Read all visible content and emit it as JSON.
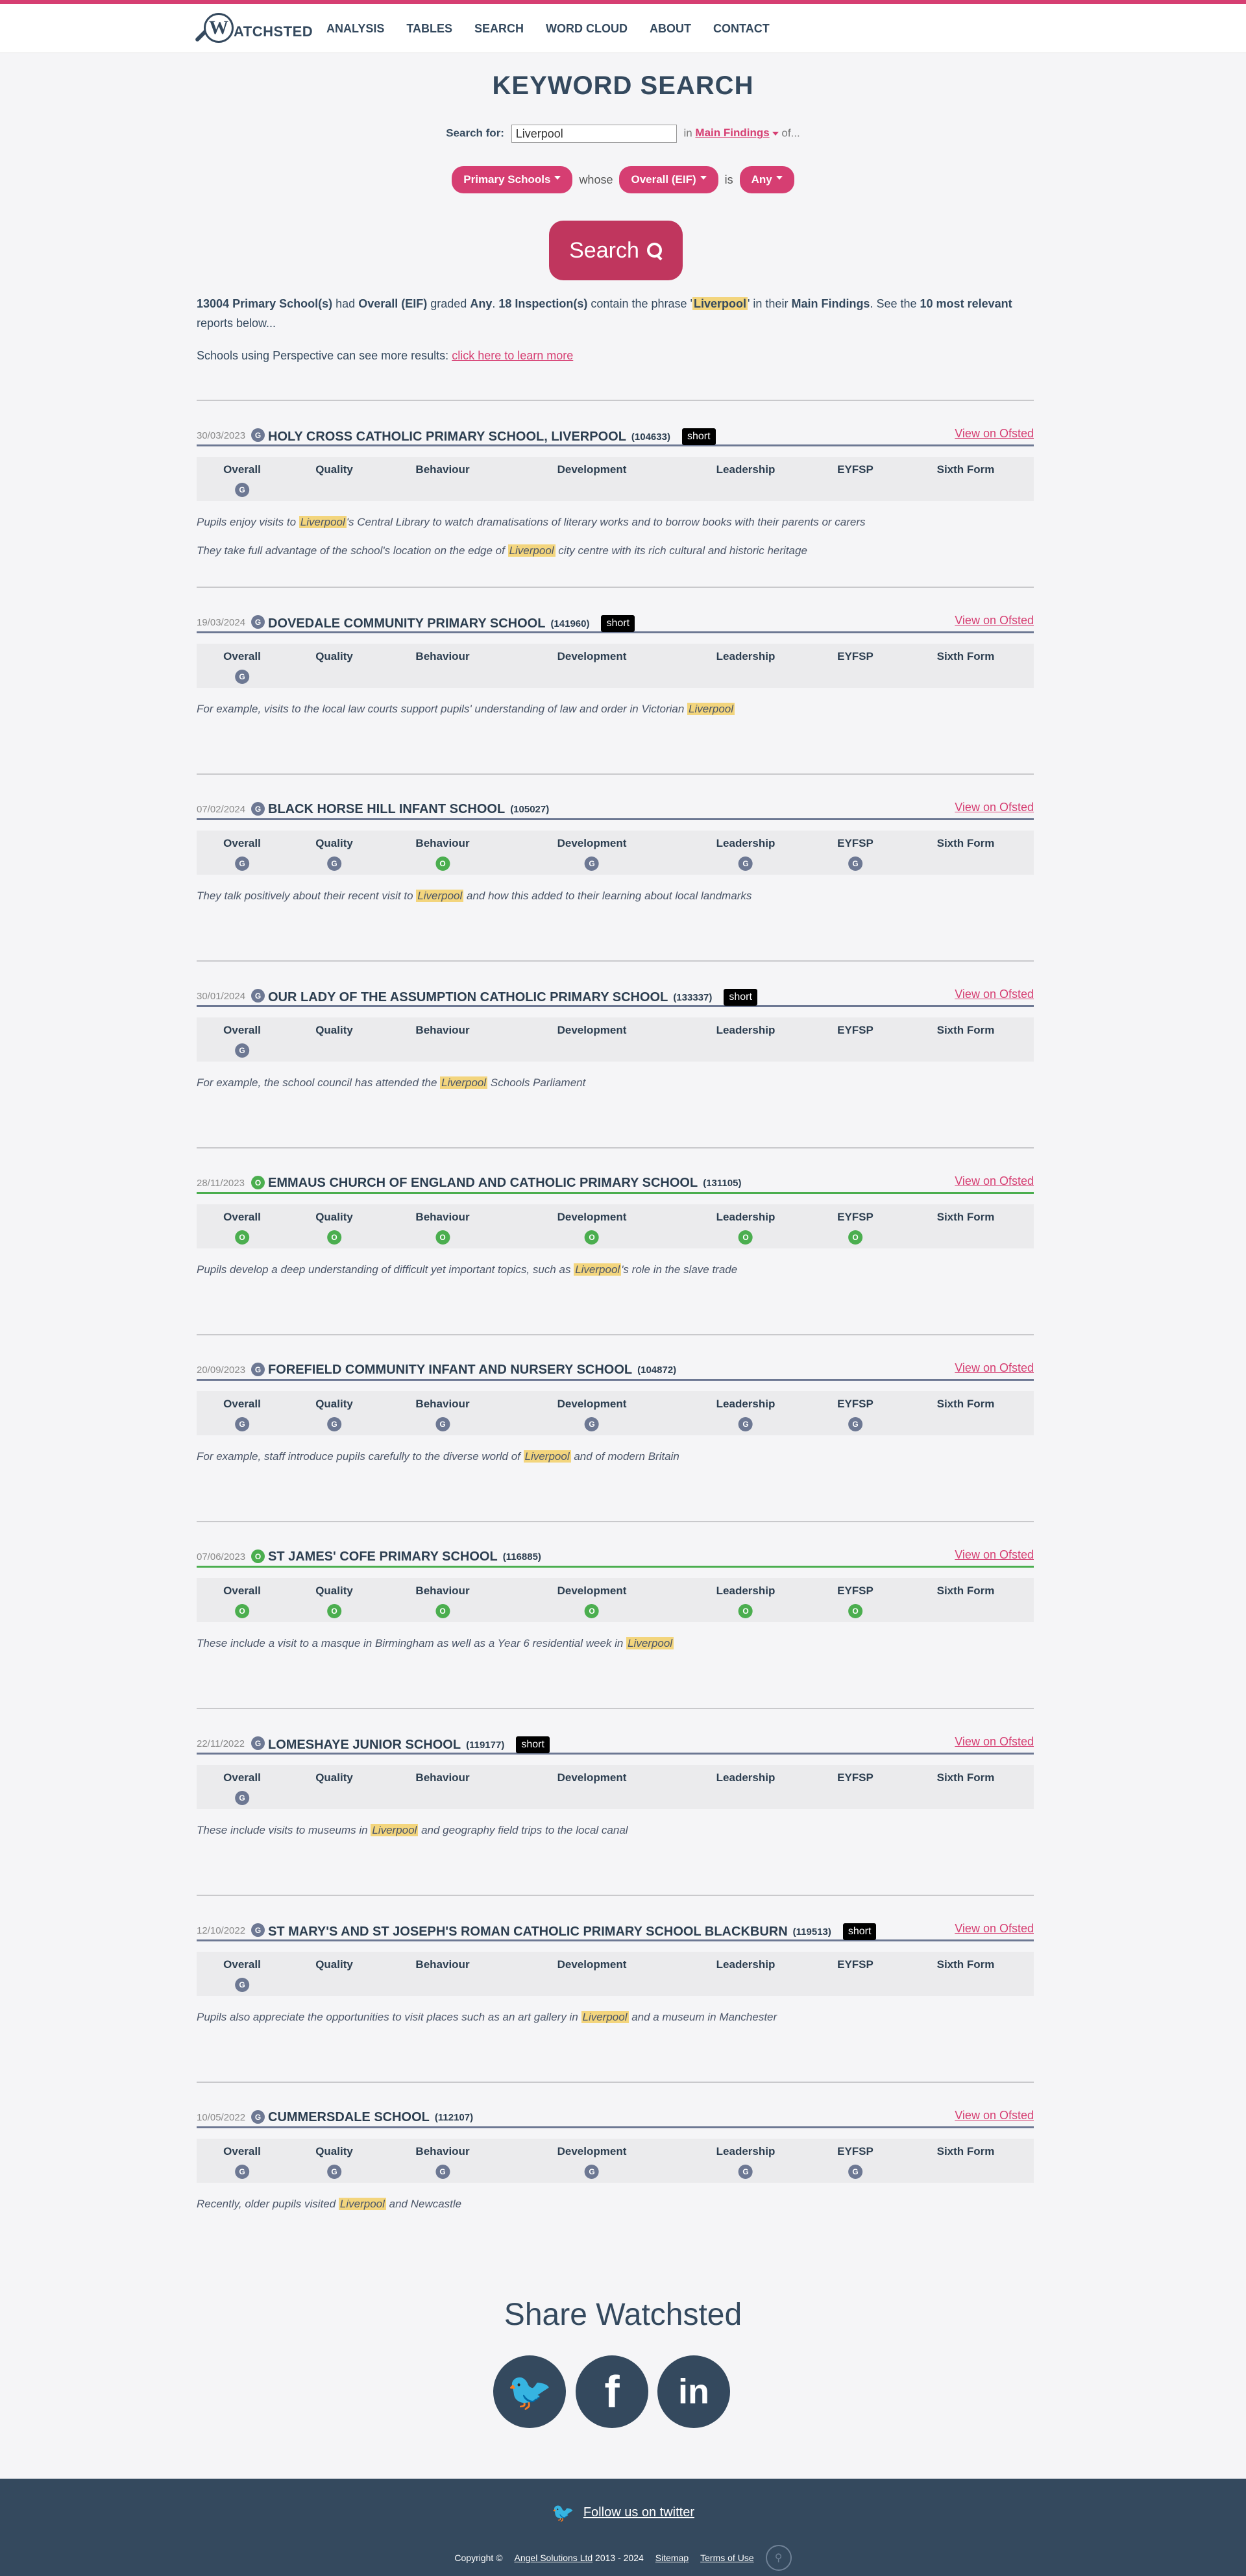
{
  "nav": {
    "logo_letter": "W",
    "logo_text": "ATCHSTED",
    "items": [
      "ANALYSIS",
      "TABLES",
      "SEARCH",
      "WORD CLOUD",
      "ABOUT",
      "CONTACT"
    ]
  },
  "page_title": "KEYWORD SEARCH",
  "search": {
    "label": "Search for:",
    "value": "Liverpool",
    "in_label": "in",
    "field": "Main Findings",
    "of_label": "of..."
  },
  "filters": {
    "school_type": "Primary Schools",
    "whose_label": "whose",
    "grade_field": "Overall (EIF)",
    "is_label": "is",
    "grade_value": "Any"
  },
  "search_button": "Search",
  "summary": {
    "count": "13004",
    "school_type": "Primary School(s)",
    "had": "had",
    "field": "Overall (EIF)",
    "graded": "graded",
    "grade": "Any",
    "inspections": "18 Inspection(s)",
    "contain": "contain the phrase '",
    "phrase": "Liverpool",
    "in_their": "' in their",
    "section": "Main Findings",
    "see": ". See the",
    "top": "10 most relevant",
    "tail": "reports below..."
  },
  "promo": {
    "text": "Schools using Perspective can see more results:",
    "link": "click here to learn more"
  },
  "grade_labels": [
    "Overall",
    "Quality",
    "Behaviour",
    "Development",
    "Leadership",
    "EYFSP",
    "Sixth Form"
  ],
  "view_label": "View on Ofsted",
  "short_label": "short",
  "colors": {
    "accent": "#d63e72",
    "good": "#6d7893",
    "outstanding": "#4bae4f",
    "highlight": "#f3d57d"
  },
  "results": [
    {
      "date": "30/03/2023",
      "icon": "G",
      "name": "HOLY CROSS CATHOLIC PRIMARY SCHOOL, LIVERPOOL",
      "urn": "(104633)",
      "short": true,
      "grades": [
        "G",
        "",
        "",
        "",
        "",
        "",
        ""
      ],
      "quotes": [
        [
          "Pupils enjoy visits to ",
          "Liverpool",
          "'s Central Library to watch dramatisations of literary works and to borrow books with their parents or carers"
        ],
        [
          "They take full advantage of the school's location on the edge of ",
          "Liverpool",
          " city centre with its rich cultural and historic heritage"
        ]
      ]
    },
    {
      "date": "19/03/2024",
      "icon": "G",
      "name": "DOVEDALE COMMUNITY PRIMARY SCHOOL",
      "urn": "(141960)",
      "short": true,
      "grades": [
        "G",
        "",
        "",
        "",
        "",
        "",
        ""
      ],
      "quotes": [
        [
          "For example, visits to the local law courts support pupils' understanding of law and order in Victorian ",
          "Liverpool",
          ""
        ]
      ]
    },
    {
      "date": "07/02/2024",
      "icon": "G",
      "name": "BLACK HORSE HILL INFANT SCHOOL",
      "urn": "(105027)",
      "short": false,
      "grades": [
        "G",
        "G",
        "O",
        "G",
        "G",
        "G",
        ""
      ],
      "quotes": [
        [
          "They talk positively about their recent visit to ",
          "Liverpool",
          " and how this added to their learning about local landmarks"
        ]
      ]
    },
    {
      "date": "30/01/2024",
      "icon": "G",
      "name": "OUR LADY OF THE ASSUMPTION CATHOLIC PRIMARY SCHOOL",
      "urn": "(133337)",
      "short": true,
      "grades": [
        "G",
        "",
        "",
        "",
        "",
        "",
        ""
      ],
      "quotes": [
        [
          "For example, the school council has attended the ",
          "Liverpool",
          " Schools Parliament"
        ]
      ]
    },
    {
      "date": "28/11/2023",
      "icon": "O",
      "name": "EMMAUS CHURCH OF ENGLAND AND CATHOLIC PRIMARY SCHOOL",
      "urn": "(131105)",
      "short": false,
      "grades": [
        "O",
        "O",
        "O",
        "O",
        "O",
        "O",
        ""
      ],
      "quotes": [
        [
          "Pupils develop a deep understanding of difficult yet important topics, such as ",
          "Liverpool",
          "'s role in the slave trade"
        ]
      ]
    },
    {
      "date": "20/09/2023",
      "icon": "G",
      "name": "FOREFIELD COMMUNITY INFANT AND NURSERY SCHOOL",
      "urn": "(104872)",
      "short": false,
      "grades": [
        "G",
        "G",
        "G",
        "G",
        "G",
        "G",
        ""
      ],
      "quotes": [
        [
          "For example, staff introduce pupils carefully to the diverse world of ",
          "Liverpool",
          " and of modern Britain"
        ]
      ]
    },
    {
      "date": "07/06/2023",
      "icon": "O",
      "name": "ST JAMES' COFE PRIMARY SCHOOL",
      "urn": "(116885)",
      "short": false,
      "grades": [
        "O",
        "O",
        "O",
        "O",
        "O",
        "O",
        ""
      ],
      "quotes": [
        [
          "These include a visit to a masque in Birmingham as well as a Year 6 residential week in ",
          "Liverpool",
          ""
        ]
      ]
    },
    {
      "date": "22/11/2022",
      "icon": "G",
      "name": "LOMESHAYE JUNIOR SCHOOL",
      "urn": "(119177)",
      "short": true,
      "grades": [
        "G",
        "",
        "",
        "",
        "",
        "",
        ""
      ],
      "quotes": [
        [
          "These include visits to museums in ",
          "Liverpool",
          " and geography field trips to the local canal"
        ]
      ]
    },
    {
      "date": "12/10/2022",
      "icon": "G",
      "name": "ST MARY'S AND ST JOSEPH'S ROMAN CATHOLIC PRIMARY SCHOOL BLACKBURN",
      "urn": "(119513)",
      "short": true,
      "grades": [
        "G",
        "",
        "",
        "",
        "",
        "",
        ""
      ],
      "quotes": [
        [
          "Pupils also appreciate the opportunities to visit places such as an art gallery in ",
          "Liverpool",
          " and a museum in Manchester"
        ]
      ]
    },
    {
      "date": "10/05/2022",
      "icon": "G",
      "name": "CUMMERSDALE SCHOOL",
      "urn": "(112107)",
      "short": false,
      "grades": [
        "G",
        "G",
        "G",
        "G",
        "G",
        "G",
        ""
      ],
      "quotes": [
        [
          "Recently, older pupils visited ",
          "Liverpool",
          " and Newcastle"
        ]
      ]
    }
  ],
  "share": {
    "title": "Share Watchsted",
    "icons": [
      "twitter-icon",
      "facebook-icon",
      "linkedin-icon"
    ],
    "twitter_glyph": "🐦",
    "facebook_glyph": "f",
    "linkedin_glyph": "in"
  },
  "footer": {
    "twitter": "Follow us on twitter",
    "copyright": "Copyright ©",
    "company": "Angel Solutions Ltd",
    "years": "2013 - 2024",
    "sitemap": "Sitemap",
    "terms": "Terms of Use"
  }
}
